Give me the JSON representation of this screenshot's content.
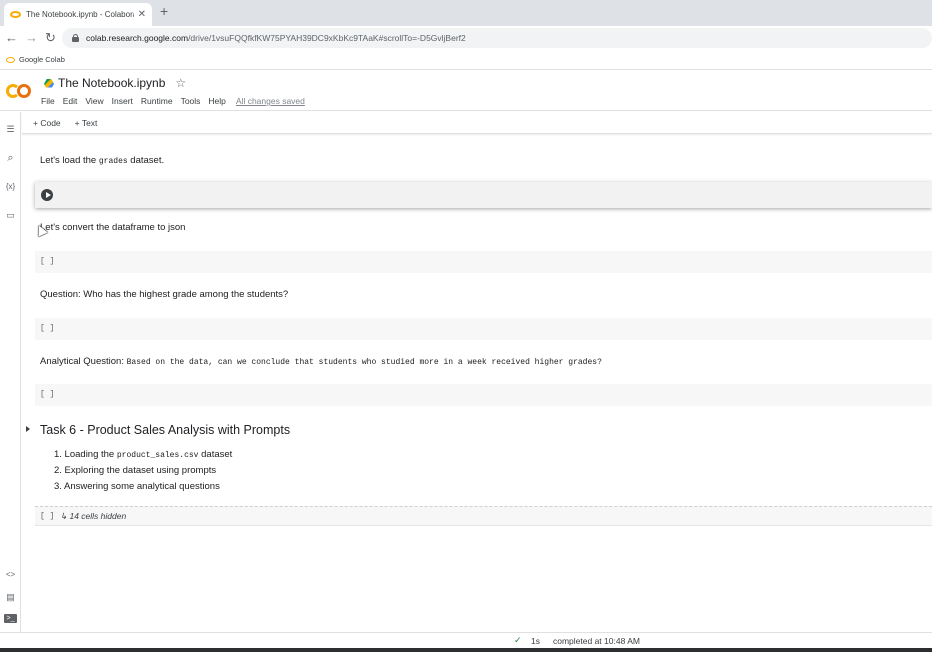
{
  "browser": {
    "tab_title": "The Notebook.ipynb - Colabora",
    "tab_close": "✕",
    "new_tab": "+",
    "back": "←",
    "forward": "→",
    "reload": "↻",
    "url_host": "colab.research.google.com",
    "url_path": "/drive/1vsuFQQfkfKW75PYAH39DC9xKbKc9TAaK#scrollTo=-D5GvljBerf2",
    "bookmark": "Google Colab"
  },
  "header": {
    "notebook_title": "The Notebook.ipynb",
    "star": "☆",
    "menu": [
      "File",
      "Edit",
      "View",
      "Insert",
      "Runtime",
      "Tools",
      "Help"
    ],
    "save_status": "All changes saved"
  },
  "rail": {
    "toc": "☰",
    "search": "⌕",
    "variables": "{x}",
    "files": "▭",
    "snippets": "<>",
    "command_palette": "▤",
    "terminal": ">_"
  },
  "toolbar": {
    "add_code": "+ Code",
    "add_text": "+ Text"
  },
  "cells": {
    "load_pre": "Let's load the ",
    "load_code": "grades",
    "load_post": " dataset.",
    "convert": "Let's convert the dataframe to json",
    "question": "Question: Who has the highest grade among the students?",
    "analytical_label": "Analytical Question: ",
    "analytical_text": "Based on the data, can we conclude that students who studied more in a week received higher grades?",
    "empty_brackets": "[ ]"
  },
  "section": {
    "heading": "Task 6 - Product Sales Analysis with Prompts",
    "item1_pre": "1. Loading the ",
    "item1_code": "product_sales.csv",
    "item1_post": " dataset",
    "item2": "2. Exploring the dataset using prompts",
    "item3": "3. Answering some analytical questions",
    "hidden_brackets": "[ ]",
    "hidden_label": "↳ 14 cells hidden"
  },
  "status": {
    "check": "✓",
    "duration": "1s",
    "completed": "completed at 10:48 AM"
  }
}
